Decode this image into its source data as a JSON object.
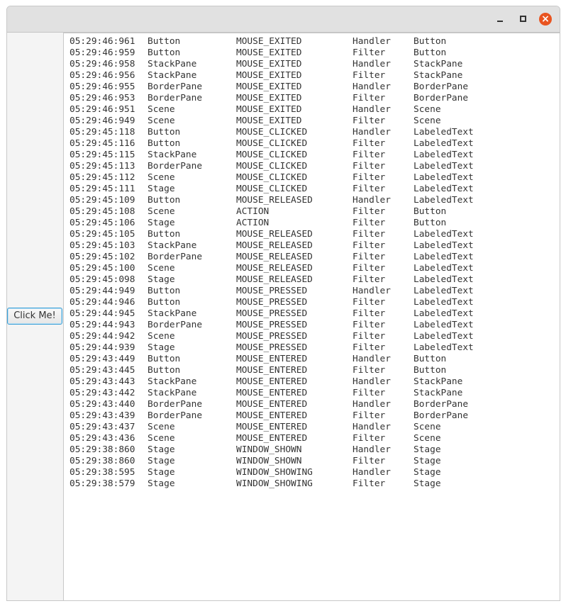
{
  "window": {
    "controls": {
      "minimize": "minimize",
      "maximize": "maximize",
      "close": "×"
    },
    "close_color": "#e95420"
  },
  "button": {
    "label": "Click Me!"
  },
  "log_rows": [
    [
      "05:29:46:961",
      "Button",
      "MOUSE_EXITED",
      "Handler",
      "Button"
    ],
    [
      "05:29:46:959",
      "Button",
      "MOUSE_EXITED",
      "Filter",
      "Button"
    ],
    [
      "05:29:46:958",
      "StackPane",
      "MOUSE_EXITED",
      "Handler",
      "StackPane"
    ],
    [
      "05:29:46:956",
      "StackPane",
      "MOUSE_EXITED",
      "Filter",
      "StackPane"
    ],
    [
      "05:29:46:955",
      "BorderPane",
      "MOUSE_EXITED",
      "Handler",
      "BorderPane"
    ],
    [
      "05:29:46:953",
      "BorderPane",
      "MOUSE_EXITED",
      "Filter",
      "BorderPane"
    ],
    [
      "05:29:46:951",
      "Scene",
      "MOUSE_EXITED",
      "Handler",
      "Scene"
    ],
    [
      "05:29:46:949",
      "Scene",
      "MOUSE_EXITED",
      "Filter",
      "Scene"
    ],
    [
      "05:29:45:118",
      "Button",
      "MOUSE_CLICKED",
      "Handler",
      "LabeledText"
    ],
    [
      "05:29:45:116",
      "Button",
      "MOUSE_CLICKED",
      "Filter",
      "LabeledText"
    ],
    [
      "05:29:45:115",
      "StackPane",
      "MOUSE_CLICKED",
      "Filter",
      "LabeledText"
    ],
    [
      "05:29:45:113",
      "BorderPane",
      "MOUSE_CLICKED",
      "Filter",
      "LabeledText"
    ],
    [
      "05:29:45:112",
      "Scene",
      "MOUSE_CLICKED",
      "Filter",
      "LabeledText"
    ],
    [
      "05:29:45:111",
      "Stage",
      "MOUSE_CLICKED",
      "Filter",
      "LabeledText"
    ],
    [
      "05:29:45:109",
      "Button",
      "MOUSE_RELEASED",
      "Handler",
      "LabeledText"
    ],
    [
      "05:29:45:108",
      "Scene",
      "ACTION",
      "Filter",
      "Button"
    ],
    [
      "05:29:45:106",
      "Stage",
      "ACTION",
      "Filter",
      "Button"
    ],
    [
      "05:29:45:105",
      "Button",
      "MOUSE_RELEASED",
      "Filter",
      "LabeledText"
    ],
    [
      "05:29:45:103",
      "StackPane",
      "MOUSE_RELEASED",
      "Filter",
      "LabeledText"
    ],
    [
      "05:29:45:102",
      "BorderPane",
      "MOUSE_RELEASED",
      "Filter",
      "LabeledText"
    ],
    [
      "05:29:45:100",
      "Scene",
      "MOUSE_RELEASED",
      "Filter",
      "LabeledText"
    ],
    [
      "05:29:45:098",
      "Stage",
      "MOUSE_RELEASED",
      "Filter",
      "LabeledText"
    ],
    [
      "05:29:44:949",
      "Button",
      "MOUSE_PRESSED",
      "Handler",
      "LabeledText"
    ],
    [
      "05:29:44:946",
      "Button",
      "MOUSE_PRESSED",
      "Filter",
      "LabeledText"
    ],
    [
      "05:29:44:945",
      "StackPane",
      "MOUSE_PRESSED",
      "Filter",
      "LabeledText"
    ],
    [
      "05:29:44:943",
      "BorderPane",
      "MOUSE_PRESSED",
      "Filter",
      "LabeledText"
    ],
    [
      "05:29:44:942",
      "Scene",
      "MOUSE_PRESSED",
      "Filter",
      "LabeledText"
    ],
    [
      "05:29:44:939",
      "Stage",
      "MOUSE_PRESSED",
      "Filter",
      "LabeledText"
    ],
    [
      "05:29:43:449",
      "Button",
      "MOUSE_ENTERED",
      "Handler",
      "Button"
    ],
    [
      "05:29:43:445",
      "Button",
      "MOUSE_ENTERED",
      "Filter",
      "Button"
    ],
    [
      "05:29:43:443",
      "StackPane",
      "MOUSE_ENTERED",
      "Handler",
      "StackPane"
    ],
    [
      "05:29:43:442",
      "StackPane",
      "MOUSE_ENTERED",
      "Filter",
      "StackPane"
    ],
    [
      "05:29:43:440",
      "BorderPane",
      "MOUSE_ENTERED",
      "Handler",
      "BorderPane"
    ],
    [
      "05:29:43:439",
      "BorderPane",
      "MOUSE_ENTERED",
      "Filter",
      "BorderPane"
    ],
    [
      "05:29:43:437",
      "Scene",
      "MOUSE_ENTERED",
      "Handler",
      "Scene"
    ],
    [
      "05:29:43:436",
      "Scene",
      "MOUSE_ENTERED",
      "Filter",
      "Scene"
    ],
    [
      "05:29:38:860",
      "Stage",
      "WINDOW_SHOWN",
      "Handler",
      "Stage"
    ],
    [
      "05:29:38:860",
      "Stage",
      "WINDOW_SHOWN",
      "Filter",
      "Stage"
    ],
    [
      "05:29:38:595",
      "Stage",
      "WINDOW_SHOWING",
      "Handler",
      "Stage"
    ],
    [
      "05:29:38:579",
      "Stage",
      "WINDOW_SHOWING",
      "Filter",
      "Stage"
    ]
  ]
}
